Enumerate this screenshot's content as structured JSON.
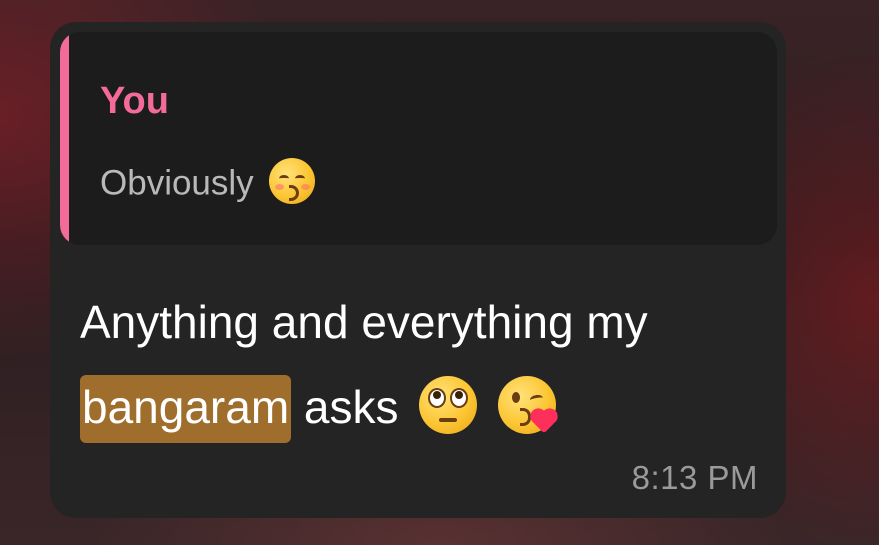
{
  "reply": {
    "author": "You",
    "text": "Obviously",
    "emoji": "kissing-closed-eyes-emoji",
    "accent_color": "#f26b9a"
  },
  "message": {
    "line1": "Anything and everything my",
    "highlighted_word": "bangaram",
    "after_highlight": "asks",
    "emojis": [
      "face-with-rolling-eyes-emoji",
      "face-blowing-a-kiss-emoji"
    ],
    "highlight_color": "#a06e2c"
  },
  "timestamp": "8:13 PM"
}
